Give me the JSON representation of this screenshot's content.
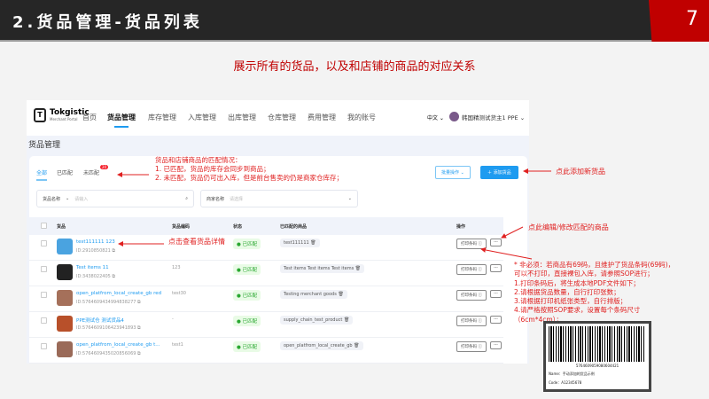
{
  "slide": {
    "title": "2.货品管理-货品列表",
    "page_number": "7",
    "subtitle": "展示所有的货品，以及和店铺的商品的对应关系"
  },
  "app": {
    "logo": {
      "name": "Tokgistic",
      "sub": "Merchant Portal"
    },
    "nav": [
      "首页",
      "货品管理",
      "库存管理",
      "入库管理",
      "出库管理",
      "仓库管理",
      "费用管理",
      "我的账号"
    ],
    "language": "中文",
    "user": "韩国精测试货主1 PPE",
    "page_title": "货品管理",
    "tabs": [
      {
        "label": "全部"
      },
      {
        "label": "已匹配"
      },
      {
        "label": "未匹配",
        "badge": "20"
      }
    ],
    "batch_button": "批量操作",
    "add_button": "添加货品",
    "search": {
      "name_label": "货品名称",
      "name_placeholder": "请输入",
      "merchant_label": "商家名称",
      "merchant_placeholder": "请选择"
    },
    "columns": [
      "货品",
      "货品编码",
      "状态",
      "已匹配的商品",
      "操作"
    ],
    "rows": [
      {
        "name": "test111111 123",
        "id": "ID:2910850821",
        "code": "",
        "status": "已匹配",
        "matched": "test111111",
        "action": "打印条码",
        "thumb": "#4aa3e0"
      },
      {
        "name": "Test items 11",
        "id": "ID:3438022405",
        "code": "123",
        "status": "已匹配",
        "matched": "Test items Test items Test items",
        "action": "打印条码",
        "thumb": "#222222"
      },
      {
        "name": "open_platfrom_local_create_gb red",
        "id": "ID:5764609434994838277",
        "code": "test30",
        "status": "已匹配",
        "matched": "Testing merchant goods",
        "action": "打印条码",
        "thumb": "#a5705a"
      },
      {
        "name": "PPE测试仓 测试货品4",
        "id": "ID:5764609106423941893",
        "code": "-",
        "status": "已匹配",
        "matched": "supply_chain_test_product",
        "action": "打印条码",
        "thumb": "#b8502a"
      },
      {
        "name": "open_platfrom_local_create_gb t...",
        "id": "ID:5764609435020856069",
        "code": "test1",
        "status": "已匹配",
        "matched": "open_platfrom_local_create_gb",
        "action": "打印条码",
        "thumb": "#9a6a58"
      }
    ]
  },
  "annotations": {
    "match_info": [
      "货品和店铺商品的匹配情况：",
      "1.    已匹配，货品的库存会同步到商品；",
      "2.    未匹配，货品仍可出入库，但是前台售卖的仍是商家仓库存；"
    ],
    "add_new": "点此添加新货品",
    "edit_match": "点此编辑/修改匹配的商品",
    "view_detail": "点击查看货品详情",
    "print_note": [
      "* 非必须：若商品有69码，且维护了货品条码(69码)，",
      "可以不打印，直接裸包入库，请参照SOP进行；",
      "1.打印条码后，将生成本地PDF文件如下；",
      "2.请根据货品数量，自行打印张数；",
      "3.请根据打印机纸张类型，自行排版；",
      "4.请严格按照SOP要求，设置每个条码尺寸",
      "（6cm*4cm）；"
    ]
  },
  "barcode": {
    "number": "5764609059080604421",
    "name": "Name：手动添加的货品示例",
    "code": "Code：A12345678"
  }
}
